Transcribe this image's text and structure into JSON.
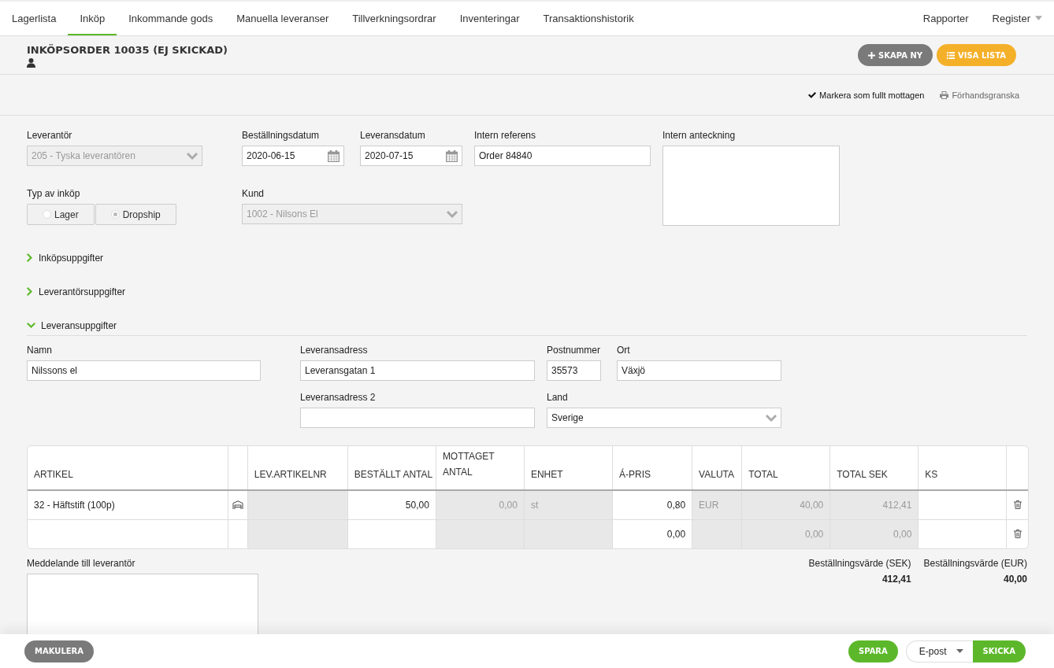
{
  "nav": {
    "tabs": [
      {
        "label": "Lagerlista",
        "selected": false
      },
      {
        "label": "Inköp",
        "selected": true
      },
      {
        "label": "Inkommande gods",
        "selected": false
      },
      {
        "label": "Manuella leveranser",
        "selected": false
      },
      {
        "label": "Tillverkningsordrar",
        "selected": false
      },
      {
        "label": "Inventeringar",
        "selected": false
      },
      {
        "label": "Transaktionshistorik",
        "selected": false
      }
    ],
    "right": [
      {
        "label": "Rapporter",
        "dropdown": false
      },
      {
        "label": "Register",
        "dropdown": true
      }
    ]
  },
  "header": {
    "title": "INKÖPSORDER 10035 (EJ SKICKAD)",
    "buttons": [
      {
        "label": "SKAPA NY",
        "kind": "create"
      },
      {
        "label": "VISA LISTA",
        "kind": "list"
      }
    ]
  },
  "actions": [
    {
      "label": "Markera som fullt mottagen",
      "kind": "check"
    },
    {
      "label": "Förhandsgranska",
      "kind": "print"
    }
  ],
  "form": {
    "supplier": {
      "label": "Leverantör",
      "value": "205 - Tyska leverantören",
      "disabled": true
    },
    "order_date": {
      "label": "Beställningsdatum",
      "value": "2020-06-15"
    },
    "delivery_date": {
      "label": "Leveransdatum",
      "value": "2020-07-15"
    },
    "internal_reference": {
      "label": "Intern referens",
      "value": "Order 84840"
    },
    "internal_note": {
      "label": "Intern anteckning"
    },
    "purchase_type": {
      "label": "Typ av inköp",
      "disabled": true,
      "options": [
        {
          "label": "Lager",
          "selected": false
        },
        {
          "label": "Dropship",
          "selected": true
        }
      ]
    },
    "customer": {
      "label": "Kund",
      "value": "1002 - Nilsons El",
      "disabled": true
    }
  },
  "sections": [
    {
      "title": "Inköpsuppgifter",
      "expanded": false
    },
    {
      "title": "Leverantörsuppgifter",
      "expanded": false
    },
    {
      "title": "Leveransuppgifter",
      "expanded": true
    }
  ],
  "delivery": {
    "name": {
      "label": "Namn",
      "value": "Nilssons el"
    },
    "address": {
      "label": "Leveransadress",
      "value": "Leveransgatan 1"
    },
    "postcode": {
      "label": "Postnummer",
      "value": "35573"
    },
    "city": {
      "label": "Ort",
      "value": "Växjö"
    },
    "address2": {
      "label": "Leveransadress 2"
    },
    "country": {
      "label": "Land",
      "value": "Sverige"
    }
  },
  "table": {
    "columns": [
      {
        "label": "ARTIKEL",
        "readonly": false,
        "kind": "text"
      },
      {
        "readonly": false,
        "kind": "icon"
      },
      {
        "label": "LEV.ARTIKELNR",
        "readonly": true,
        "kind": "text"
      },
      {
        "label": "BESTÄLLT ANTAL",
        "readonly": false,
        "kind": "number"
      },
      {
        "label": "MOTTAGET ANTAL",
        "readonly": true,
        "kind": "number"
      },
      {
        "label": "ENHET",
        "readonly": true,
        "kind": "text"
      },
      {
        "label": "Á-PRIS",
        "readonly": false,
        "kind": "number"
      },
      {
        "label": "VALUTA",
        "readonly": true,
        "kind": "text"
      },
      {
        "label": "TOTAL",
        "readonly": true,
        "kind": "number"
      },
      {
        "label": "TOTAL SEK",
        "readonly": true,
        "kind": "number"
      },
      {
        "label": "KS",
        "readonly": false,
        "kind": "text"
      },
      {
        "readonly": false,
        "kind": "action"
      }
    ],
    "rows": [
      {
        "item_icon": true,
        "cells": [
          "32 - Häftstift (100p)",
          null,
          null,
          "50,00",
          "0,00",
          "st",
          "0,80",
          "EUR",
          "40,00",
          "412,41",
          null,
          null
        ]
      },
      {
        "item_icon": false,
        "cells": [
          null,
          null,
          null,
          null,
          null,
          null,
          "0,00",
          null,
          "0,00",
          "0,00",
          null,
          null
        ]
      }
    ]
  },
  "message": {
    "label": "Meddelande till leverantör"
  },
  "totals": [
    {
      "label": "Beställningsvärde (SEK)",
      "value": "412,41"
    },
    {
      "label": "Beställningsvärde (EUR)",
      "value": "40,00"
    }
  ],
  "footer": {
    "cancel": "MAKULERA",
    "save": "SPARA",
    "send_method": "E-post",
    "send": "SKICKA"
  }
}
